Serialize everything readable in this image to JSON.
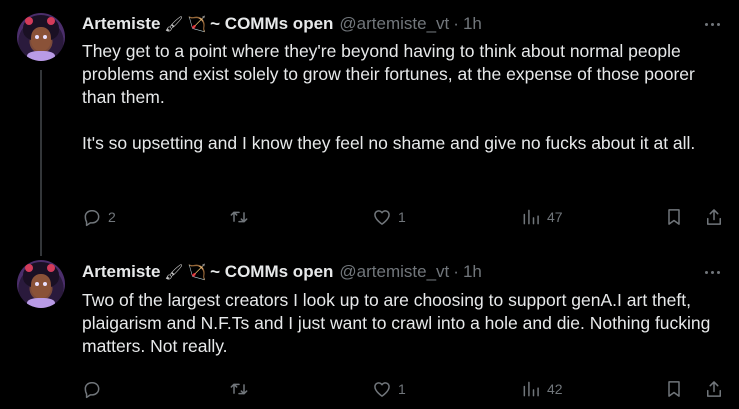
{
  "tweets": [
    {
      "author": "Artemiste",
      "pen_emoji": "🖌",
      "bow_emoji": "🏹",
      "comms": "~ COMMs open",
      "handle": "@artemiste_vt",
      "separator": "·",
      "time": "1h",
      "paragraphs": [
        "They get to a point where they're beyond having to think about normal people problems and exist solely to grow their fortunes, at the expense of those poorer than them.",
        "It's so upsetting and I know they feel no shame and give no fucks about it at all."
      ],
      "replies": "2",
      "retweets": "",
      "likes": "1",
      "views": "47"
    },
    {
      "author": "Artemiste",
      "pen_emoji": "🖌",
      "bow_emoji": "🏹",
      "comms": "~ COMMs open",
      "handle": "@artemiste_vt",
      "separator": "·",
      "time": "1h",
      "paragraphs": [
        "Two of the largest creators I look up to are choosing to support genA.I art theft, plaigarism and N.F.Ts and I just want to crawl into a hole and die. Nothing fucking matters. Not really."
      ],
      "replies": "",
      "retweets": "",
      "likes": "1",
      "views": "42"
    }
  ],
  "colors": {
    "background": "#000000",
    "text": "#e7e9ea",
    "muted": "#71767b",
    "thread_line": "#333639"
  },
  "icons": [
    "reply-icon",
    "retweet-icon",
    "like-icon",
    "views-icon",
    "bookmark-icon",
    "share-icon",
    "more-icon"
  ]
}
